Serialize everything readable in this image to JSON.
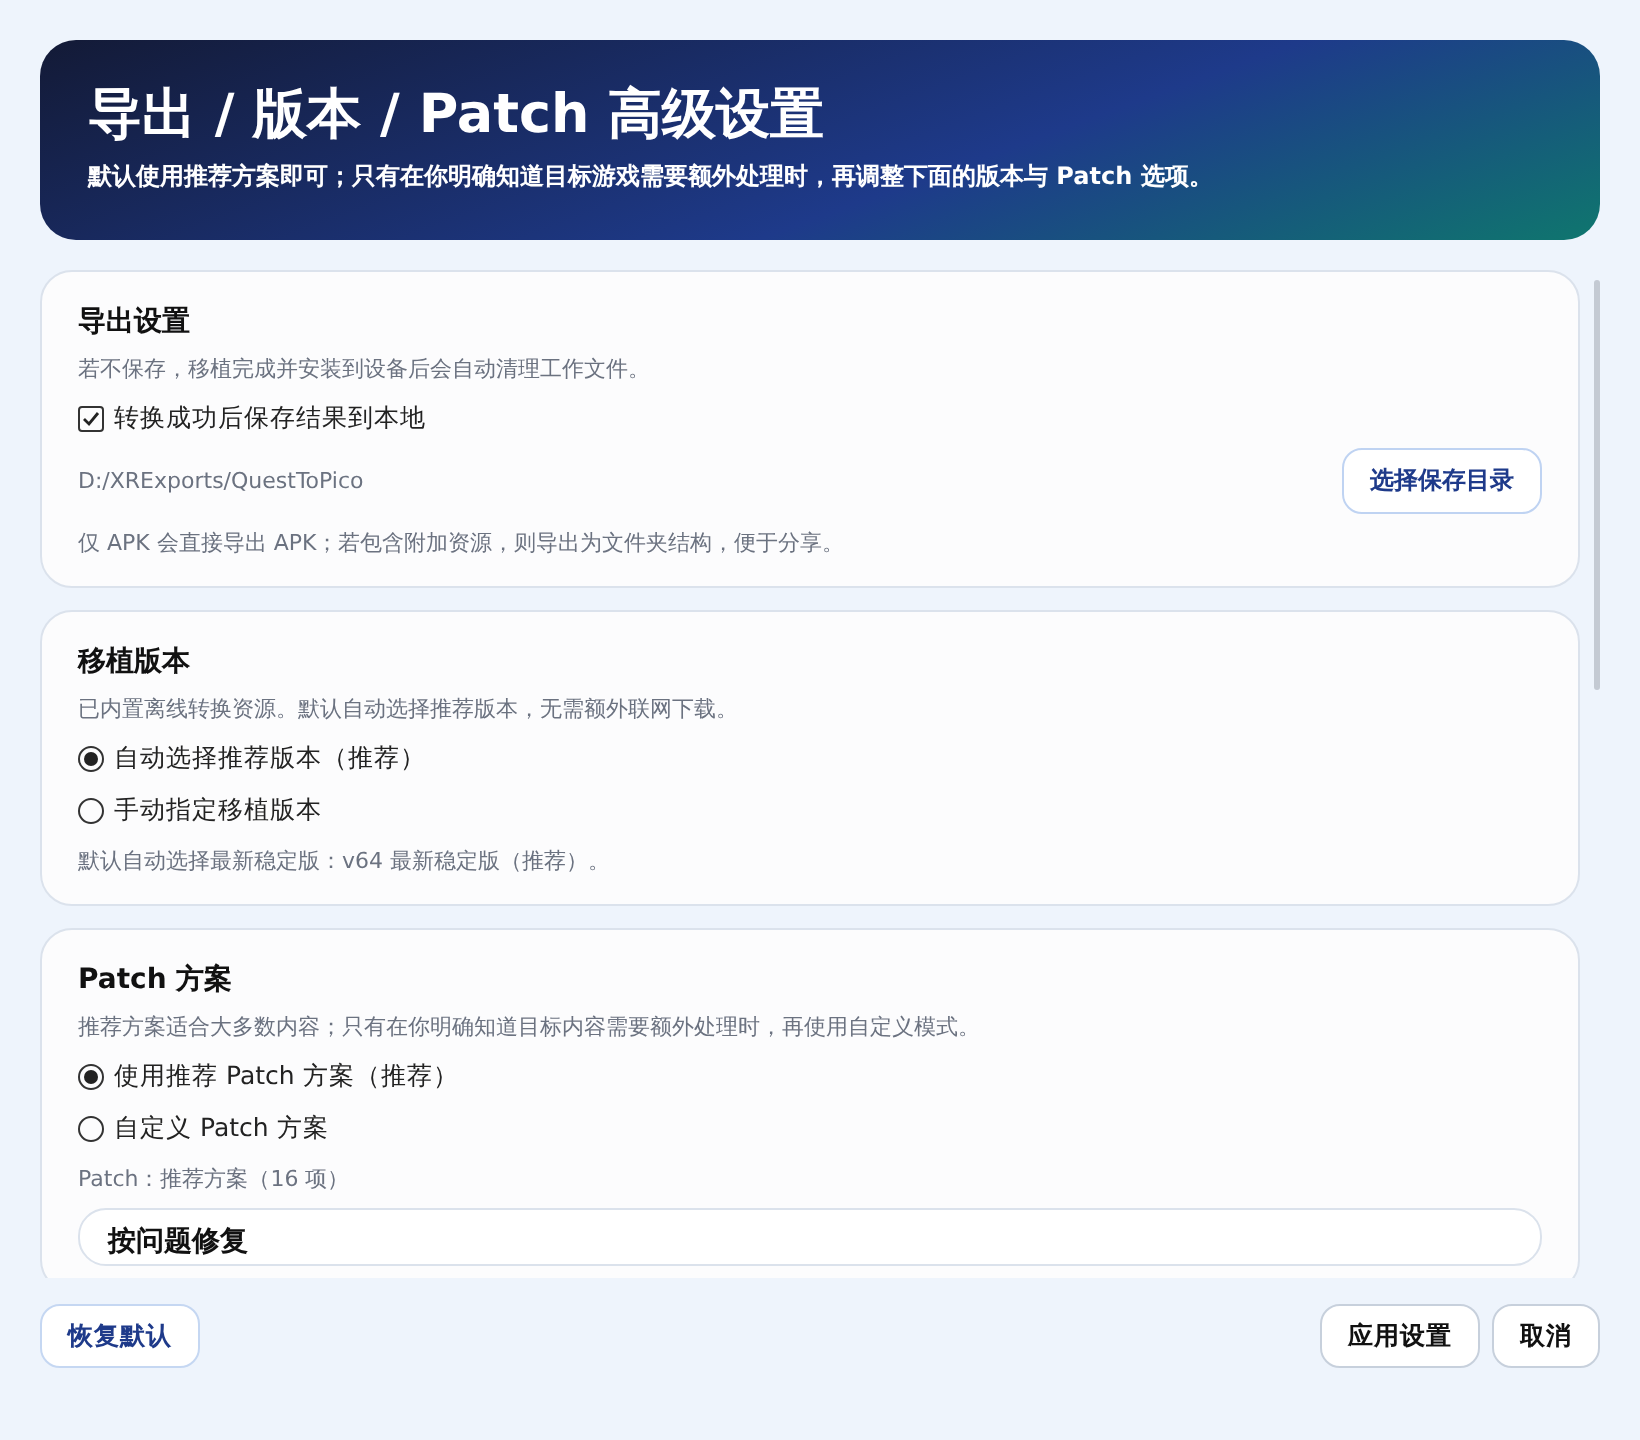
{
  "header": {
    "title": "导出 / 版本 / Patch 高级设置",
    "subtitle": "默认使用推荐方案即可；只有在你明确知道目标游戏需要额外处理时，再调整下面的版本与 Patch 选项。"
  },
  "sections": [
    {
      "title": "导出设置",
      "description": "若不保存，移植完成并安装到设备后会自动清理工作文件。",
      "items": [
        {
          "kind": "checkbox",
          "label": "转换成功后保存结果到本地",
          "checked": true
        },
        {
          "kind": "path",
          "value": "D:/XRExports/QuestToPico",
          "button": "选择保存目录"
        },
        {
          "kind": "note",
          "text": "仅 APK 会直接导出 APK；若包含附加资源，则导出为文件夹结构，便于分享。"
        }
      ]
    },
    {
      "title": "移植版本",
      "description": "已内置离线转换资源。默认自动选择推荐版本，无需额外联网下载。",
      "items": [
        {
          "kind": "radio",
          "label": "自动选择推荐版本（推荐）",
          "selected": true
        },
        {
          "kind": "radio",
          "label": "手动指定移植版本",
          "selected": false
        },
        {
          "kind": "note",
          "text": "默认自动选择最新稳定版：v64 最新稳定版（推荐）。"
        }
      ]
    },
    {
      "title": "Patch 方案",
      "description": "推荐方案适合大多数内容；只有在你明确知道目标内容需要额外处理时，再使用自定义模式。",
      "items": [
        {
          "kind": "radio",
          "label": "使用推荐 Patch 方案（推荐）",
          "selected": true
        },
        {
          "kind": "radio",
          "label": "自定义 Patch 方案",
          "selected": false
        },
        {
          "kind": "note",
          "text": "Patch：推荐方案（16 项）"
        },
        {
          "kind": "subcard",
          "title": "按问题修复"
        }
      ]
    }
  ],
  "footer": {
    "reset": "恢复默认",
    "apply": "应用设置",
    "cancel": "取消"
  }
}
